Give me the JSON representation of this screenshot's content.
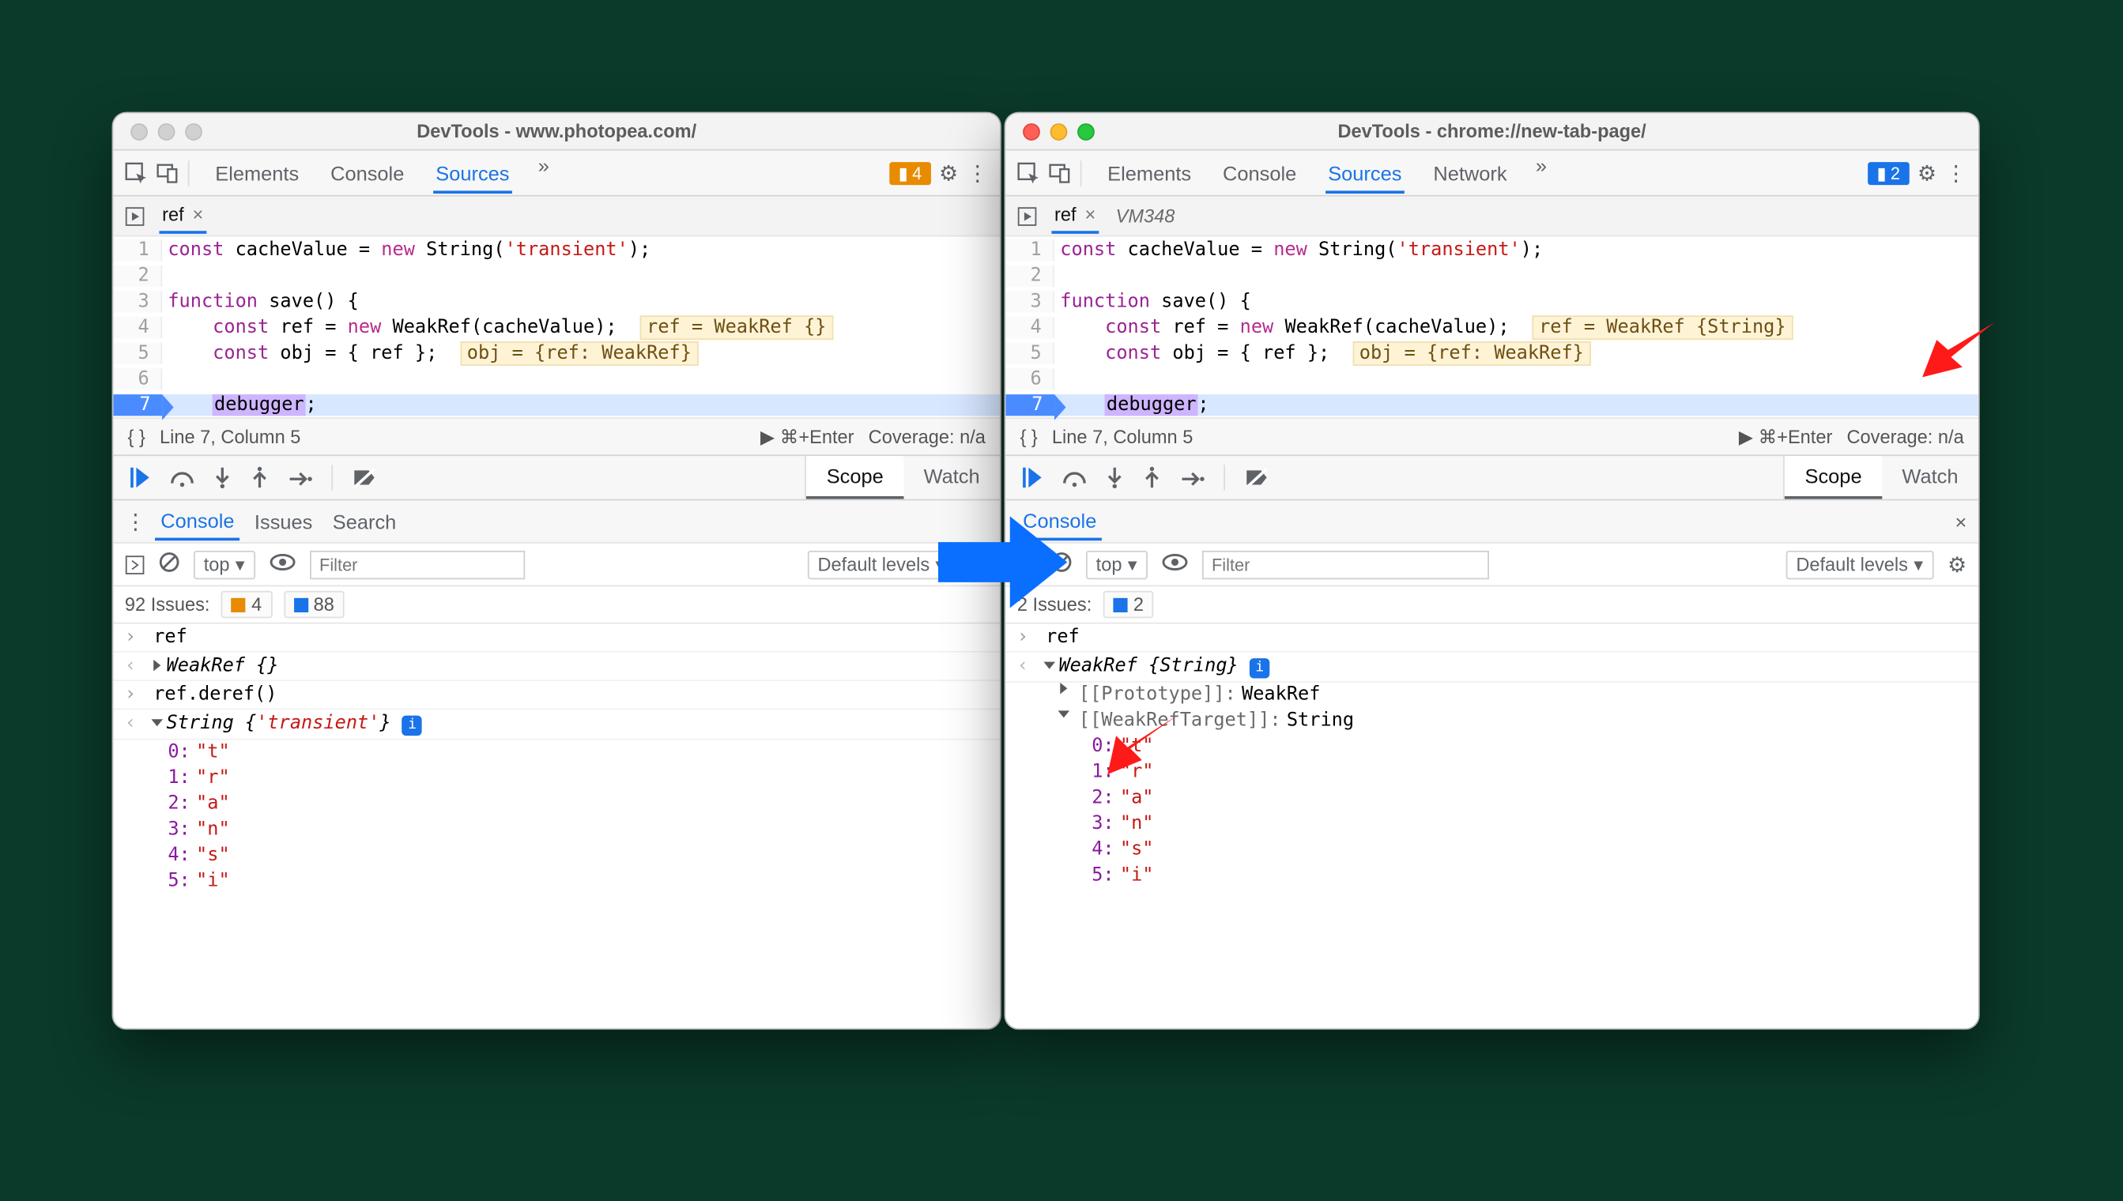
{
  "left": {
    "title": "DevTools - www.photopea.com/",
    "tabs": [
      "Elements",
      "Console",
      "Sources"
    ],
    "active_tab": "Sources",
    "warn_count": "4",
    "file_tab": "ref",
    "editor_status_left": "Line 7, Column 5",
    "editor_status_run": "⌘+Enter",
    "editor_status_cov": "Coverage: n/a",
    "scope_tabs": [
      "Scope",
      "Watch"
    ],
    "drawer_tabs": [
      "Console",
      "Issues",
      "Search"
    ],
    "console_context": "top",
    "filter_placeholder": "Filter",
    "levels_label": "Default levels",
    "issues_total": "92 Issues:",
    "issues_warn": "4",
    "issues_info": "88",
    "console_in1": "ref",
    "console_out1": "WeakRef {}",
    "console_in2": "ref.deref()",
    "console_out2_pre": "String {",
    "console_out2_str": "'transient'",
    "console_out2_post": "}",
    "expand": [
      "t",
      "r",
      "a",
      "n",
      "s",
      "i"
    ]
  },
  "right": {
    "title": "DevTools - chrome://new-tab-page/",
    "tabs": [
      "Elements",
      "Console",
      "Sources",
      "Network"
    ],
    "active_tab": "Sources",
    "info_count": "2",
    "file_tab": "ref",
    "file_tab2": "VM348",
    "editor_status_left": "Line 7, Column 5",
    "editor_status_run": "⌘+Enter",
    "editor_status_cov": "Coverage: n/a",
    "scope_tabs": [
      "Scope",
      "Watch"
    ],
    "drawer_tabs": [
      "Console"
    ],
    "console_context": "top",
    "filter_placeholder": "Filter",
    "levels_label": "Default levels",
    "issues_total": "2 Issues:",
    "issues_info": "2",
    "console_in1": "ref",
    "console_out1": "WeakRef {String}",
    "internal_proto_label": "[[Prototype]]:",
    "internal_proto_val": "WeakRef",
    "internal_target_label": "[[WeakRefTarget]]:",
    "internal_target_val": "String",
    "expand": [
      "t",
      "r",
      "a",
      "n",
      "s",
      "i"
    ]
  },
  "code": {
    "l1_a": "const",
    "l1_b": " cacheValue = ",
    "l1_c": "new",
    "l1_d": " String(",
    "l1_e": "'transient'",
    "l1_f": ");",
    "l3_a": "function",
    "l3_b": " save() {",
    "l4_a": "    ",
    "l4_b": "const",
    "l4_c": " ref = ",
    "l4_d": "new",
    "l4_e": " WeakRef(cacheValue);",
    "l4_hint_L": "ref = WeakRef {}",
    "l4_hint_R": "ref = WeakRef {String}",
    "l5_a": "    ",
    "l5_b": "const",
    "l5_c": " obj = { ref };",
    "l5_hint": "obj = {ref: WeakRef}",
    "l7_a": "    ",
    "l7_b": "debugger",
    "l7_c": ";"
  }
}
